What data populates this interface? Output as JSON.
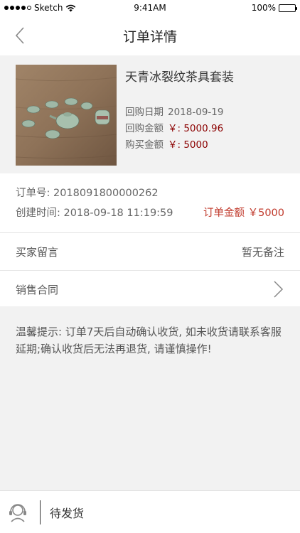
{
  "status_bar": {
    "carrier": "Sketch",
    "time": "9:41AM",
    "battery": "100%"
  },
  "nav": {
    "title": "订单详情"
  },
  "product": {
    "name": "天青冰裂纹茶具套装",
    "buyback_date_label": "回购日期",
    "buyback_date": "2018-09-19",
    "buyback_amount_label": "回购金额",
    "buyback_amount": "￥: 5000.96",
    "purchase_amount_label": "购买金额",
    "purchase_amount": "￥: 5000"
  },
  "order": {
    "number_label": "订单号: ",
    "number": "2018091800000262",
    "created_label": "创建时间: ",
    "created": "2018-09-18 11:19:59",
    "amount_label": "订单金额",
    "amount": "￥5000"
  },
  "rows": {
    "buyer_note_label": "买家留言",
    "buyer_note_value": "暂无备注",
    "contract_label": "销售合同"
  },
  "notice": {
    "text": "温馨提示: 订单7天后自动确认收货, 如未收货请联系客服延期;确认收货后无法再退货, 请谨慎操作!"
  },
  "bottom": {
    "status": "待发货"
  },
  "colors": {
    "accent_red": "#c0392b",
    "dark_red": "#8b0000",
    "gray_bg": "#f2f2f2"
  }
}
